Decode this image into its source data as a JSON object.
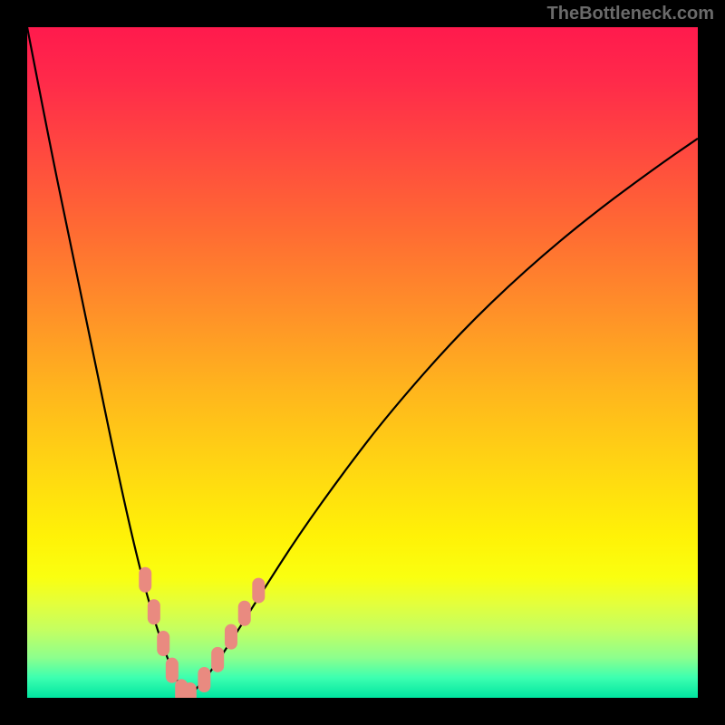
{
  "attribution": "TheBottleneck.com",
  "colors": {
    "frame": "#000000",
    "curve": "#000000",
    "marker": "#e98a80"
  },
  "chart_data": {
    "type": "line",
    "title": "",
    "xlabel": "",
    "ylabel": "",
    "xlim": [
      0,
      100
    ],
    "ylim": [
      0,
      100
    ],
    "grid": false,
    "legend": false,
    "note": "Two curves forming a V/check shape over a rainbow vertical gradient; axes unlabeled. x is normalized 0–100 left→right, y is normalized 0–100 bottom→top. Values are read off the rendered geometry (approximate).",
    "series": [
      {
        "name": "left-branch",
        "x": [
          0.0,
          3.0,
          6.1,
          9.3,
          12.4,
          15.1,
          17.4,
          19.6,
          21.6,
          23.2,
          23.8
        ],
        "y": [
          100.0,
          84.5,
          69.3,
          54.1,
          38.9,
          26.4,
          16.9,
          9.5,
          4.1,
          0.9,
          0.0
        ]
      },
      {
        "name": "right-branch",
        "x": [
          23.8,
          25.3,
          27.0,
          30.4,
          35.1,
          40.5,
          47.3,
          54.1,
          64.2,
          74.3,
          84.5,
          94.6,
          100.0
        ],
        "y": [
          0.0,
          1.4,
          3.4,
          8.4,
          15.9,
          24.3,
          33.8,
          42.6,
          54.1,
          63.8,
          72.3,
          79.7,
          83.4
        ]
      }
    ],
    "markers": {
      "note": "Rounded-rectangle salmon markers clustered near the V vertex on both branches; coordinates are centers in the same 0–100 space.",
      "points": [
        {
          "x": 17.6,
          "y": 17.6
        },
        {
          "x": 18.9,
          "y": 12.8
        },
        {
          "x": 20.3,
          "y": 8.1
        },
        {
          "x": 21.6,
          "y": 4.1
        },
        {
          "x": 23.0,
          "y": 0.9
        },
        {
          "x": 24.3,
          "y": 0.4
        },
        {
          "x": 26.4,
          "y": 2.7
        },
        {
          "x": 28.4,
          "y": 5.7
        },
        {
          "x": 30.4,
          "y": 9.1
        },
        {
          "x": 32.4,
          "y": 12.6
        },
        {
          "x": 34.5,
          "y": 16.0
        }
      ]
    }
  }
}
